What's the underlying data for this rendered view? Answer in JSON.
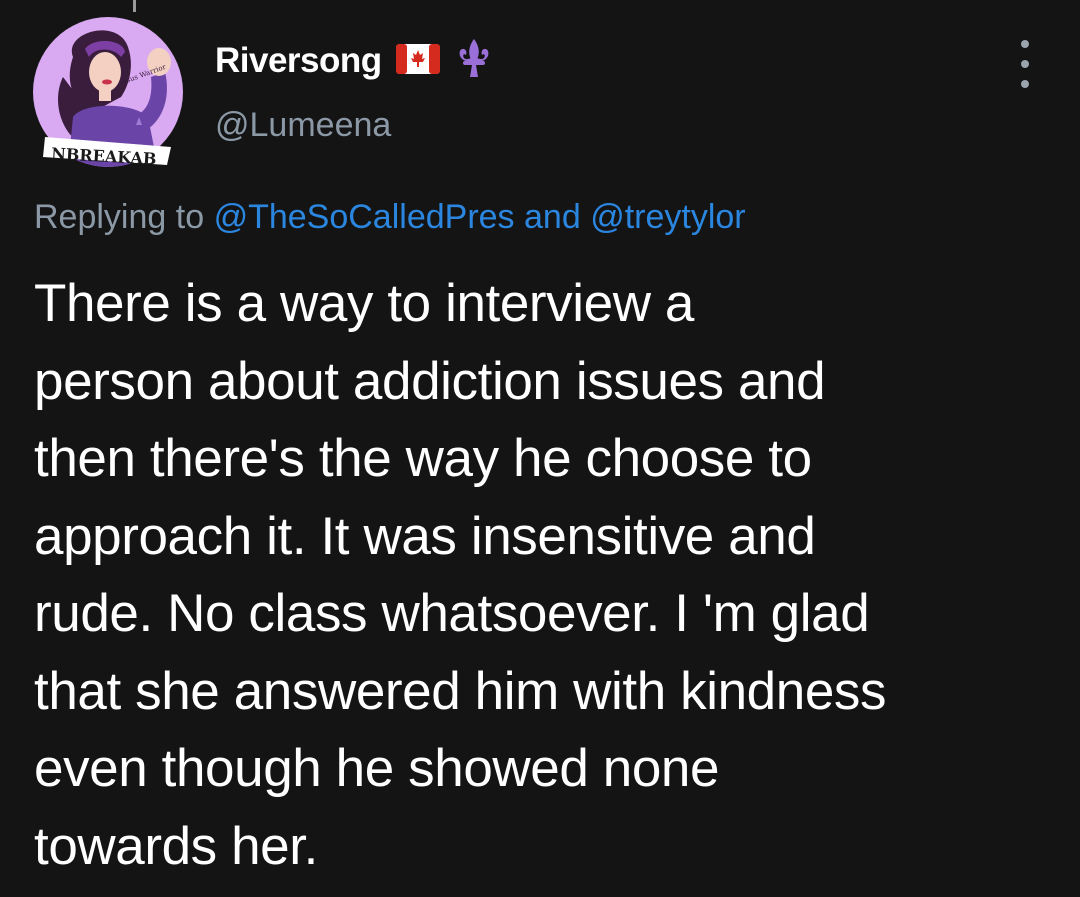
{
  "tweet": {
    "author": {
      "display_name": "Riversong",
      "handle": "@Lumeena",
      "avatar_badge_text": "NBREAKAB",
      "avatar_script_text": "Jesus Warrior",
      "name_emoji": [
        "canada-flag-icon",
        "fleur-de-lis-icon"
      ]
    },
    "more_menu_icon": "vertical-ellipsis-icon",
    "reply": {
      "prefix": "Replying to",
      "mention1": "@TheSoCalledPres",
      "conjunction": "and",
      "mention2": "@treytylor"
    },
    "body_lines": [
      "There is a way to interview a",
      "person about addiction issues and",
      "then there's the way he choose to",
      "approach it. It was insensitive and",
      "rude. No class whatsoever. I 'm glad",
      "that she answered him with kindness",
      "even though he showed none",
      "towards her."
    ]
  },
  "colors": {
    "background": "#141414",
    "text_primary": "#ffffff",
    "text_secondary": "#8b98a5",
    "link": "#2b86e0",
    "avatar_bg": "#d7a6f0",
    "fleur": "#9b6fd8"
  }
}
